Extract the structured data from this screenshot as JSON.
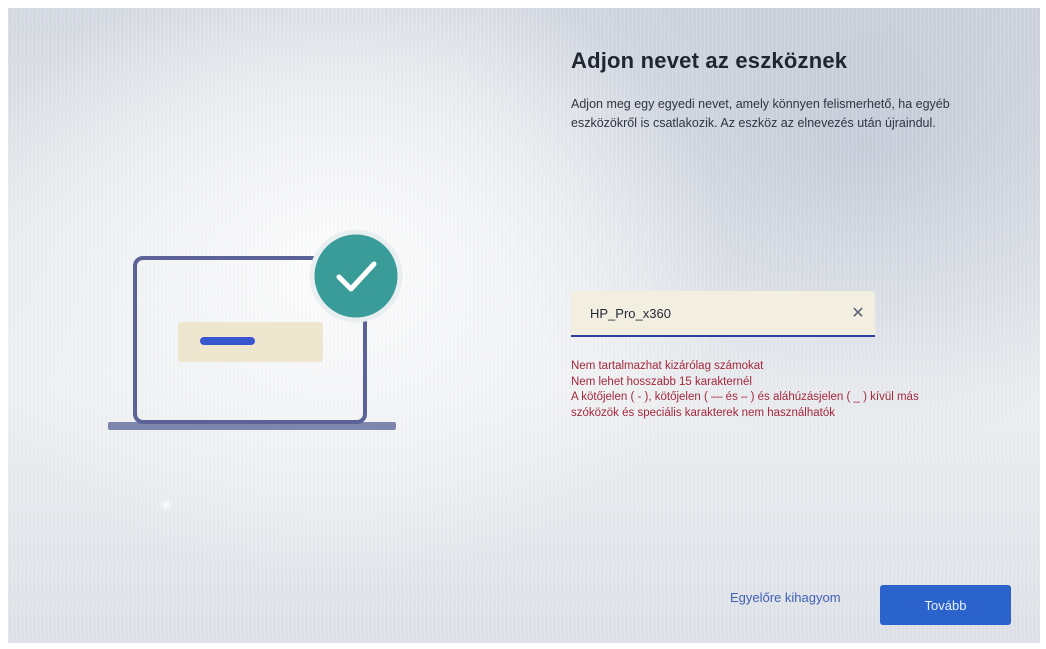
{
  "page": {
    "title": "Adjon nevet az eszköznek",
    "subtitle_line1": "Adjon meg egy egyedi nevet, amely könnyen felismerhető, ha egyéb",
    "subtitle_line2": "eszközökről is csatlakozik. Az eszköz az elnevezés után újraindul."
  },
  "device_name_field": {
    "value": "HP_Pro_x360",
    "clear_icon": "close-icon"
  },
  "validation_errors": [
    "Nem tartalmazhat kizárólag számokat",
    "Nem lehet hosszabb 15 karakternél",
    "A kötőjelen ( - ), kötőjelen ( — és – ) és aláhúzásjelen ( _ ) kívül más",
    "szóközök és speciális karakterek nem használhatók"
  ],
  "footer": {
    "skip_label": "Egyelőre kihagyom",
    "next_label": "Tovább"
  },
  "illustration": {
    "icon": "laptop-checkmark-icon"
  },
  "colors": {
    "accent": "#2a63cc",
    "error": "#a4283c",
    "check_badge": "#3a9c98",
    "laptop_outline": "#5a6298"
  }
}
